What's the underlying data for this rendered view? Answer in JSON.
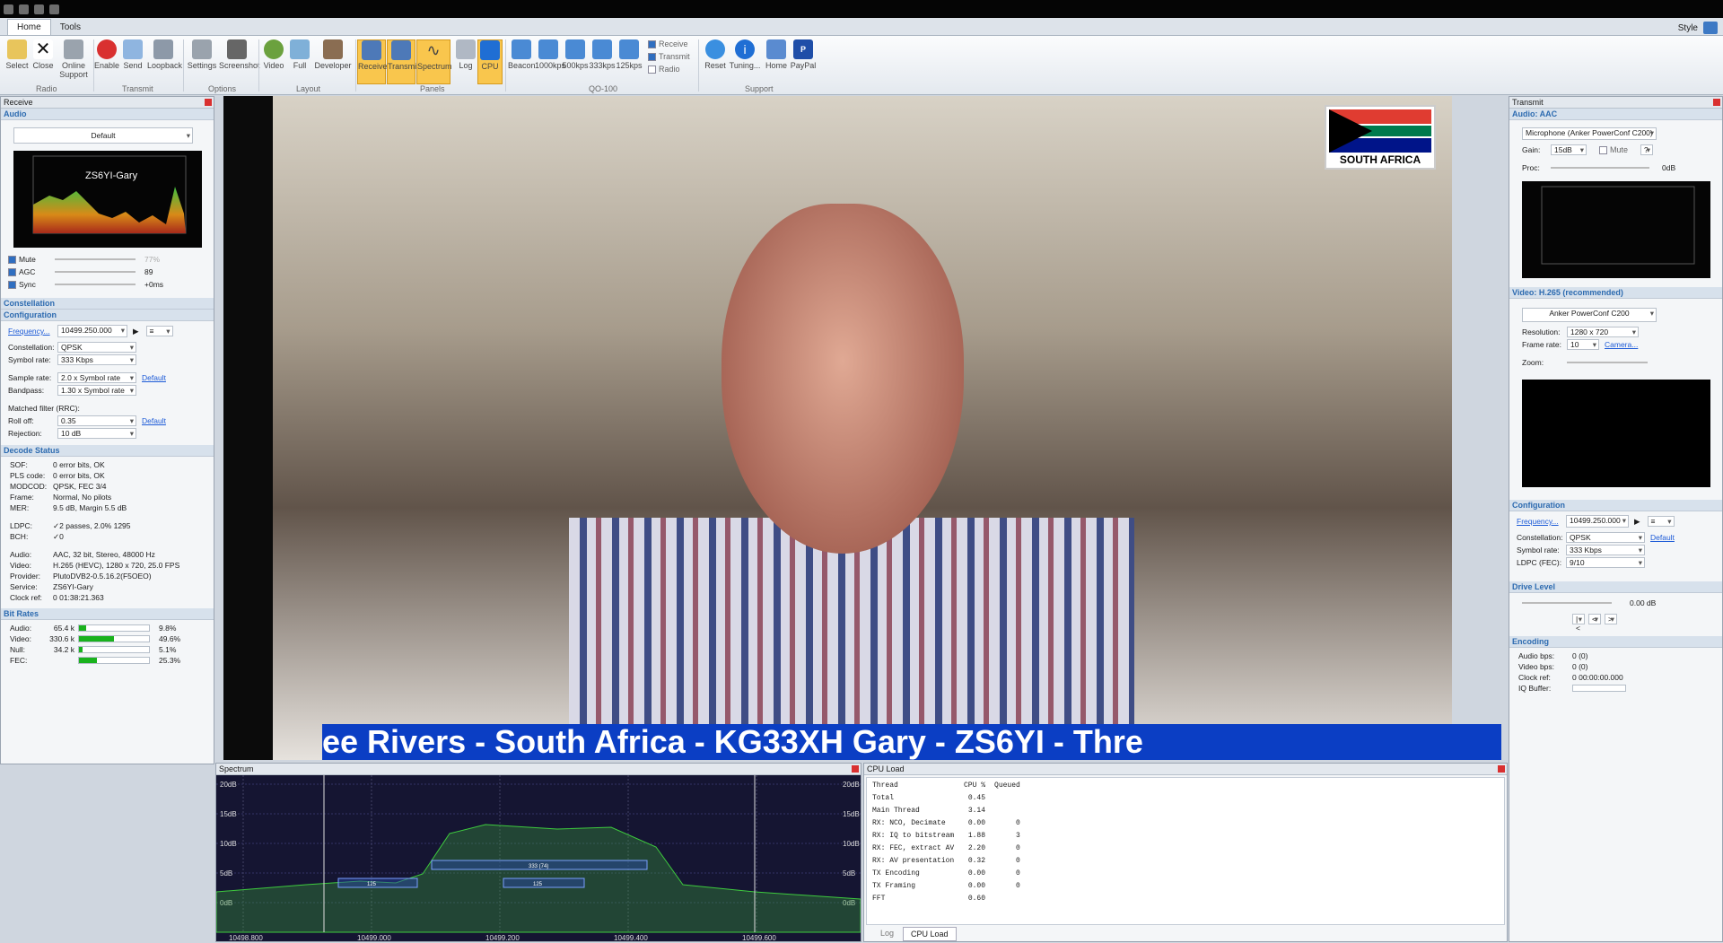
{
  "tabs": [
    "Home",
    "Tools"
  ],
  "style_label": "Style",
  "ribbon": {
    "buttons": [
      "Select",
      "Close",
      "Online Support",
      "Enable",
      "Send",
      "Loopback",
      "Settings",
      "Screenshot",
      "Video",
      "Full",
      "Developer",
      "Receive",
      "Transmit",
      "Spectrum",
      "Log",
      "CPU",
      "Beacon",
      "1000kps",
      "500kps",
      "333kps",
      "125kps",
      "Reset",
      "Tuning...",
      "Home",
      "PayPal"
    ],
    "groups": [
      "Radio",
      "Transmit",
      "Options",
      "Layout",
      "Panels",
      "QO-100",
      "Support"
    ],
    "checks": [
      "Receive",
      "Transmit",
      "Radio"
    ]
  },
  "receive": {
    "title": "Receive",
    "audio_head": "Audio",
    "device": "Default",
    "scope_label": "ZS6YI-Gary",
    "mute": "Mute",
    "mute_val": "77%",
    "agc": "AGC",
    "agc_val": "89",
    "sync": "Sync",
    "sync_val": "+0ms",
    "constellation_head": "Constellation",
    "config_head": "Configuration",
    "frequency_link": "Frequency...",
    "frequency": "10499.250.000",
    "constellation_l": "Constellation:",
    "constellation_v": "QPSK",
    "symbol_l": "Symbol rate:",
    "symbol_v": "333 Kbps",
    "sample_l": "Sample rate:",
    "sample_v": "2.0 x Symbol rate",
    "default": "Default",
    "bandpass_l": "Bandpass:",
    "bandpass_v": "1.30 x Symbol rate",
    "matched": "Matched filter (RRC):",
    "rolloff_l": "Roll off:",
    "rolloff_v": "0.35",
    "rejection_l": "Rejection:",
    "rejection_v": "10 dB",
    "decode_head": "Decode Status",
    "decode": [
      [
        "SOF:",
        "0 error bits, OK"
      ],
      [
        "PLS code:",
        "0 error bits, OK"
      ],
      [
        "MODCOD:",
        "QPSK, FEC 3/4"
      ],
      [
        "Frame:",
        "Normal,  No pilots"
      ],
      [
        "MER:",
        "9.5 dB, Margin 5.5 dB"
      ],
      [
        "LDPC:",
        "✓2 passes, 2.0% 1295"
      ],
      [
        "BCH:",
        "✓0"
      ],
      [
        "Audio:",
        "AAC, 32 bit, Stereo, 48000 Hz"
      ],
      [
        "Video:",
        "H.265 (HEVC), 1280 x 720, 25.0 FPS"
      ],
      [
        "Provider:",
        "PlutoDVB2-0.5.16.2(F5OEO)"
      ],
      [
        "Service:",
        "ZS6YI-Gary"
      ],
      [
        "Clock ref:",
        "0 01:38:21.363"
      ]
    ],
    "bitrates_head": "Bit Rates",
    "bitrates": [
      {
        "k": "Audio:",
        "v": "65.4 k",
        "p": "9.8%",
        "f": 0.098
      },
      {
        "k": "Video:",
        "v": "330.6 k",
        "p": "49.6%",
        "f": 0.496
      },
      {
        "k": "Null:",
        "v": "34.2 k",
        "p": "5.1%",
        "f": 0.051
      },
      {
        "k": "FEC:",
        "v": "",
        "p": "25.3%",
        "f": 0.253
      }
    ]
  },
  "video": {
    "flag_text": "SOUTH AFRICA",
    "ticker": "ee Rivers - South Africa - KG33XH  Gary - ZS6YI - Thre"
  },
  "transmit": {
    "title": "Transmit",
    "audio_head": "Audio: AAC",
    "mic": "Microphone (Anker PowerConf C200)",
    "gain_l": "Gain:",
    "gain_v": "15dB",
    "mute": "Mute",
    "help": "?",
    "proc_l": "Proc:",
    "proc_v": "0dB",
    "video_head": "Video: H.265 (recommended)",
    "camera": "Anker PowerConf C200",
    "res_l": "Resolution:",
    "res_v": "1280 x 720",
    "fps_l": "Frame rate:",
    "fps_v": "10",
    "camera_link": "Camera...",
    "zoom_l": "Zoom:",
    "config_head": "Configuration",
    "frequency_link": "Frequency...",
    "frequency": "10499.250.000",
    "constellation_l": "Constellation:",
    "constellation_v": "QPSK",
    "default": "Default",
    "symbol_l": "Symbol rate:",
    "symbol_v": "333 Kbps",
    "ldpc_l": "LDPC (FEC):",
    "ldpc_v": "9/10",
    "drive_head": "Drive Level",
    "drive_v": "0.00 dB",
    "encoding_head": "Encoding",
    "encoding": [
      [
        "Audio bps:",
        "0 (0)"
      ],
      [
        "Video bps:",
        "0 (0)"
      ],
      [
        "Clock ref:",
        "0 00:00:00.000"
      ],
      [
        "IQ Buffer:",
        ""
      ]
    ]
  },
  "spectrum": {
    "title": "Spectrum",
    "db_ticks": [
      "20dB",
      "15dB",
      "10dB",
      "5dB",
      "0dB"
    ],
    "freq_ticks": [
      "10498.800",
      "10499.000",
      "10499.200",
      "10499.400",
      "10499.600"
    ],
    "boxes": [
      "333 (74)",
      "125",
      "125"
    ]
  },
  "cpu": {
    "title": "CPU Load",
    "headers": [
      "Thread",
      "CPU %",
      "Queued"
    ],
    "rows": [
      [
        "Total",
        "0.45",
        ""
      ],
      [
        "Main Thread",
        "3.14",
        ""
      ],
      [
        "RX: NCO, Decimate",
        "0.00",
        "0"
      ],
      [
        "RX: IQ to bitstream",
        "1.88",
        "3"
      ],
      [
        "RX: FEC, extract AV",
        "2.20",
        "0"
      ],
      [
        "RX: AV presentation",
        "0.32",
        "0"
      ],
      [
        "TX Encoding",
        "0.00",
        "0"
      ],
      [
        "TX Framing",
        "0.00",
        "0"
      ],
      [
        "FFT",
        "0.60",
        ""
      ]
    ],
    "tabs": [
      "Log",
      "CPU Load"
    ]
  }
}
